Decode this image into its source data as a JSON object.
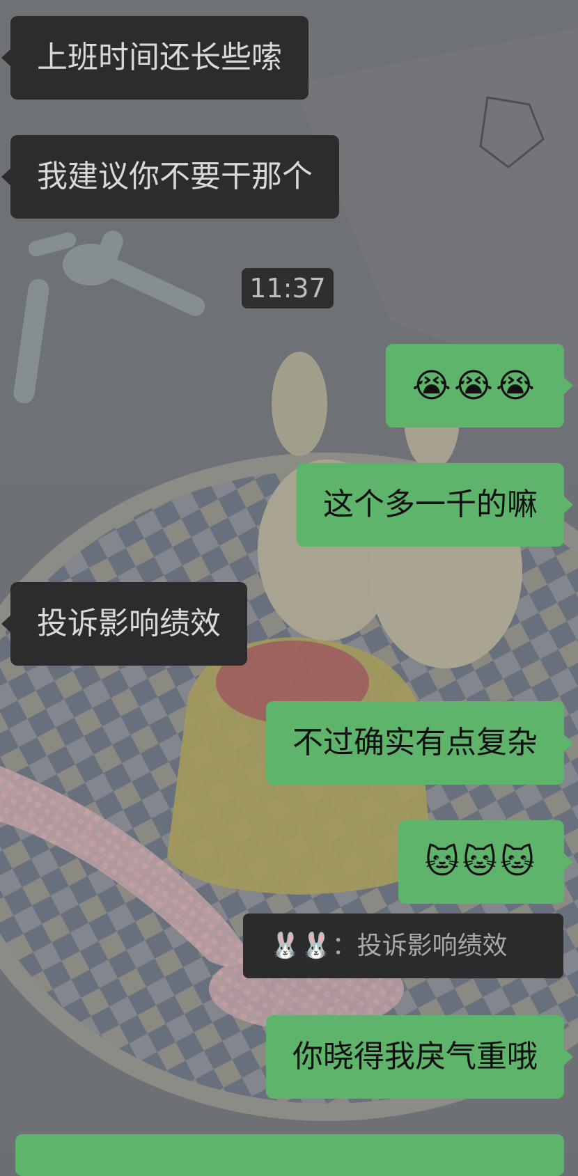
{
  "messages": [
    {
      "side": "left",
      "text": "上班时间还长些嗦"
    },
    {
      "side": "left",
      "text": "我建议你不要干那个"
    },
    {
      "side": "right",
      "text": "😭😭😭"
    },
    {
      "side": "right",
      "text": "这个多一千的嘛"
    },
    {
      "side": "left",
      "text": "投诉影响绩效"
    },
    {
      "side": "right",
      "text": "不过确实有点复杂"
    },
    {
      "side": "right",
      "text": "🐱🐱🐱"
    },
    {
      "side": "right",
      "text": "你晓得我戾气重哦"
    }
  ],
  "timestamp": "11:37",
  "quote": {
    "sender": "🐰🐰",
    "separator": "：",
    "text": "投诉影响绩效"
  },
  "colors": {
    "incoming_bubble": "#2c2c2c",
    "outgoing_bubble": "#5db46a",
    "chat_background": "#6b6e72"
  }
}
